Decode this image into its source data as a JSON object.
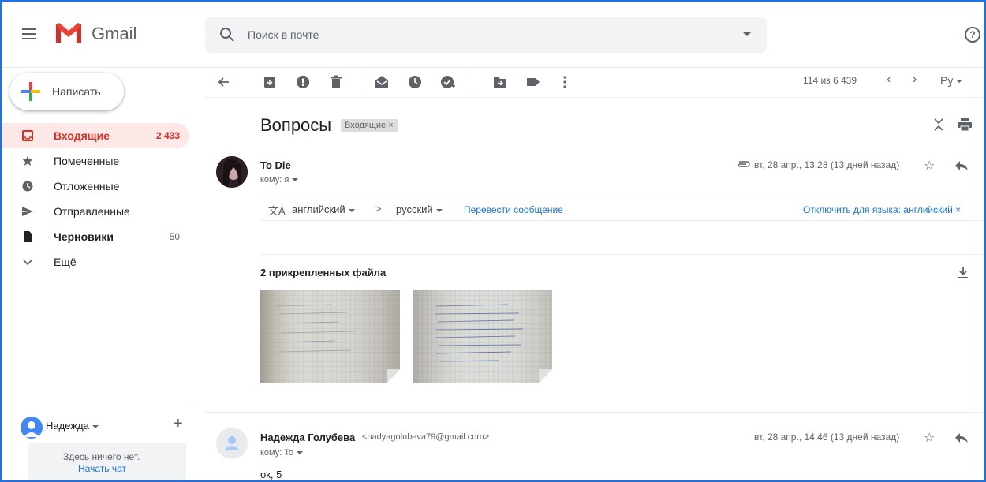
{
  "app": {
    "logo_text": "Gmail"
  },
  "search": {
    "placeholder": "Поиск в почте"
  },
  "compose": {
    "label": "Написать"
  },
  "sidebar": {
    "items": [
      {
        "label": "Входящие",
        "count": "2 433"
      },
      {
        "label": "Помеченные",
        "count": ""
      },
      {
        "label": "Отложенные",
        "count": ""
      },
      {
        "label": "Отправленные",
        "count": ""
      },
      {
        "label": "Черновики",
        "count": "50"
      },
      {
        "label": "Ещё",
        "count": ""
      }
    ]
  },
  "hangouts": {
    "user": "Надежда",
    "empty_text": "Здесь ничего нет.",
    "start_chat": "Начать чат"
  },
  "toolbar": {
    "pager": "114 из 6 439",
    "lang_label": "Ру"
  },
  "thread": {
    "subject": "Вопросы",
    "label_chip": "Входящие ×",
    "messages": [
      {
        "sender": "To Die",
        "to": "кому: я",
        "date": "вт, 28 апр., 13:28 (13 дней назад)"
      },
      {
        "sender": "Надежда Голубева",
        "email": "<nadyagolubeva79@gmail.com>",
        "to": "кому: To",
        "date": "вт, 28 апр., 14:46 (13 дней назад)",
        "body": "ок, 5"
      }
    ],
    "translate": {
      "from": "английский",
      "arrow": ">",
      "to": "русский",
      "link": "Перевести сообщение",
      "disable": "Отключить для языка: английский ×"
    },
    "attachments_title": "2 прикрепленных файла"
  },
  "colors": {
    "accent": "#1a73e8",
    "inbox_active": "#d93025",
    "inbox_active_bg": "#fce8e6"
  }
}
